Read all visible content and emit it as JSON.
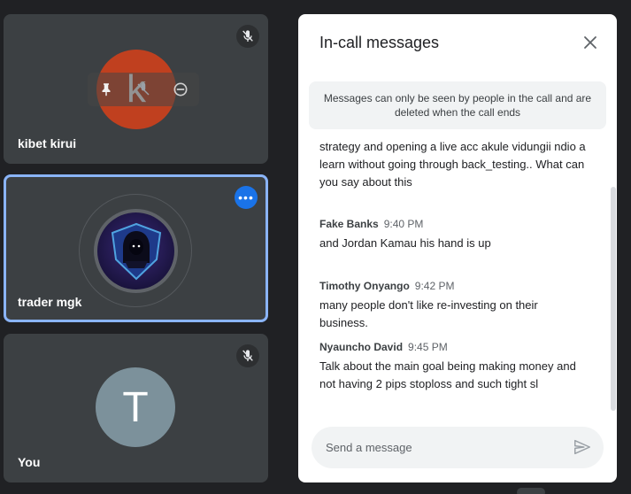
{
  "participants": [
    {
      "name": "kibet kirui",
      "initial": "k",
      "avatar_color": "#c0401f",
      "muted": true
    },
    {
      "name": "trader mgk",
      "highlighted": true,
      "highlight_color": "#8ab4f8"
    },
    {
      "name": "You",
      "initial": "T",
      "avatar_color": "#7c919b",
      "muted": true
    }
  ],
  "hover_actions": [
    "pin-icon",
    "mute-icon",
    "remove-icon"
  ],
  "more_options_label": "•••",
  "chat": {
    "title": "In-call messages",
    "notice": "Messages can only be seen by people in the call and are deleted when the call ends",
    "partial_message": "strategy and opening a live acc akule vidungii ndio a learn without going through back_testing.. What can you say about this",
    "messages": [
      {
        "sender": "Fake Banks",
        "time": "9:40 PM",
        "text": "and Jordan Kamau his hand is up"
      },
      {
        "sender": "Timothy Onyango",
        "time": "9:42 PM",
        "text": "many people don't like re-investing on their business."
      },
      {
        "sender": "Nyauncho David",
        "time": "9:45 PM",
        "text": "Talk about the main goal being making money and not having 2 pips stoploss and such tight sl"
      }
    ],
    "input_placeholder": "Send a message",
    "input_value": ""
  },
  "colors": {
    "background": "#202124",
    "tile": "#3c4043",
    "accent": "#1a73e8"
  }
}
